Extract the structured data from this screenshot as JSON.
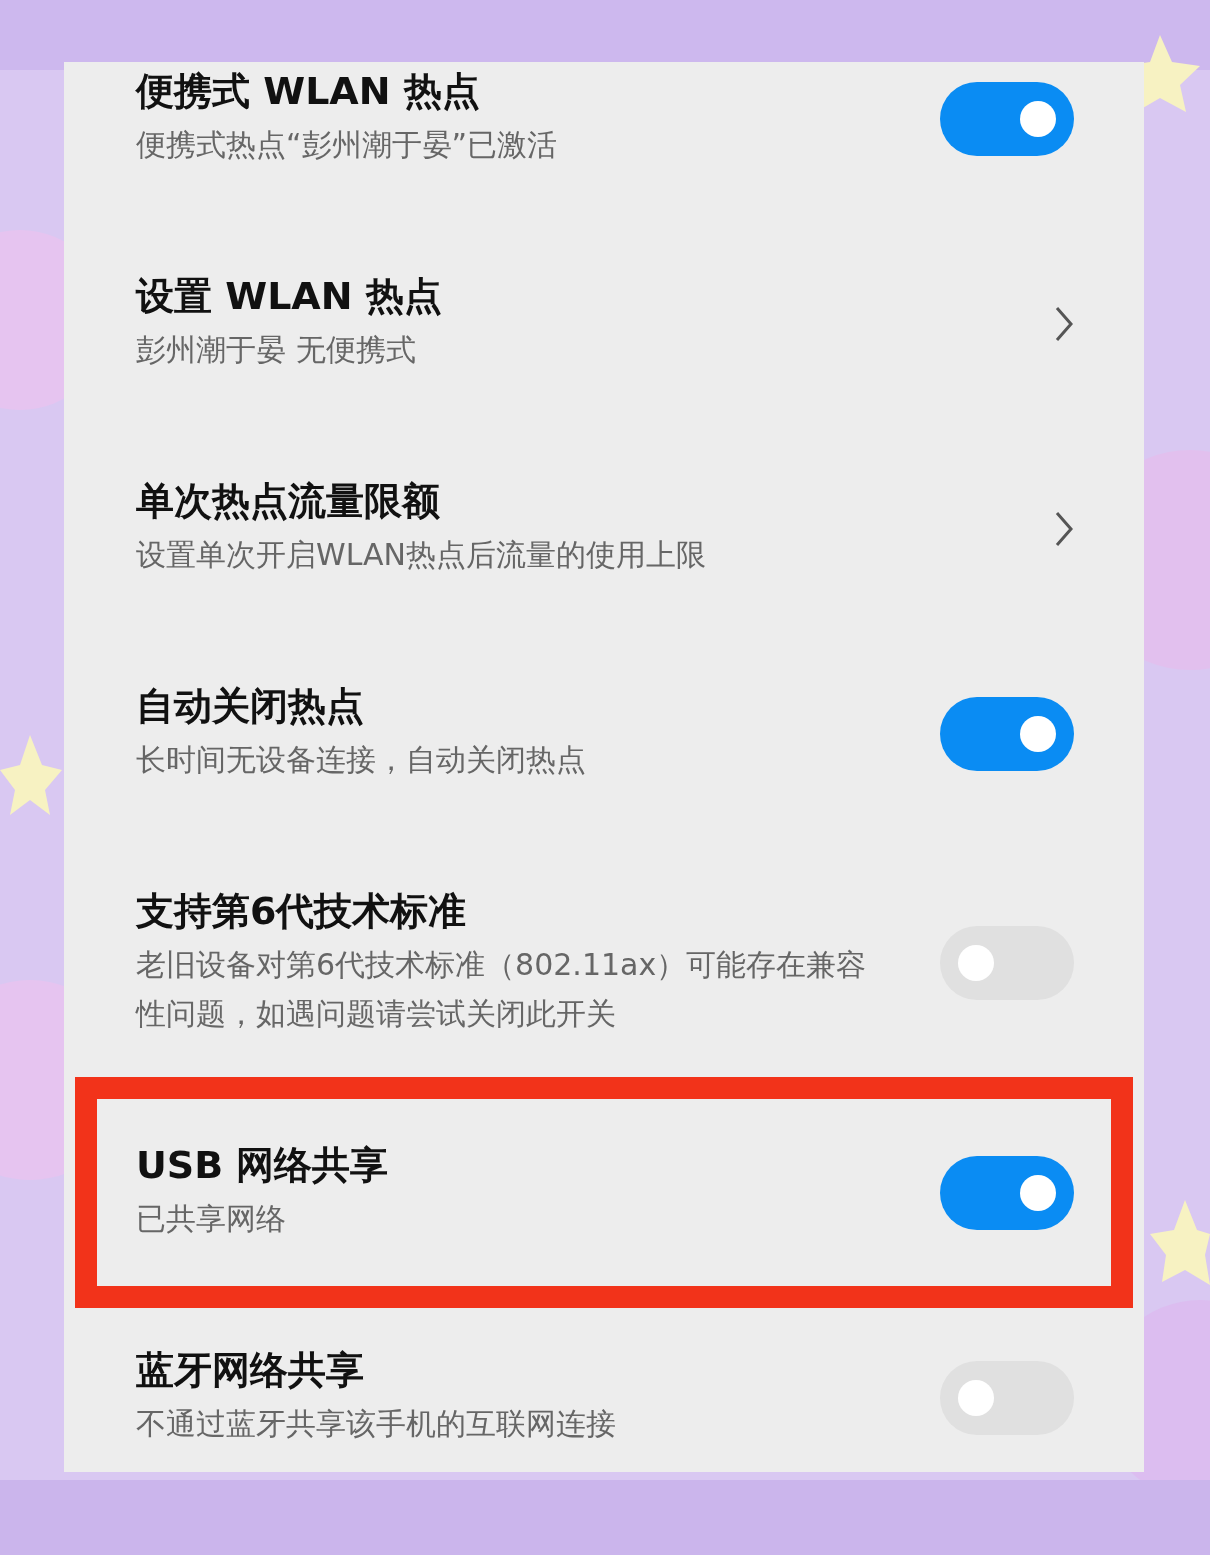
{
  "settings": [
    {
      "kind": "toggle",
      "title": "便携式 WLAN 热点",
      "subtitle": "便携式热点“彭州潮于晏”已激活",
      "on": true,
      "highlighted": false
    },
    {
      "kind": "link",
      "title": "设置 WLAN 热点",
      "subtitle": "彭州潮于晏 无便携式",
      "highlighted": false
    },
    {
      "kind": "link",
      "title": "单次热点流量限额",
      "subtitle": "设置单次开启WLAN热点后流量的使用上限",
      "highlighted": false
    },
    {
      "kind": "toggle",
      "title": "自动关闭热点",
      "subtitle": "长时间无设备连接，自动关闭热点",
      "on": true,
      "highlighted": false
    },
    {
      "kind": "toggle",
      "title": "支持第6代技术标准",
      "subtitle": "老旧设备对第6代技术标准（802.11ax）可能存在兼容性问题，如遇问题请尝试关闭此开关",
      "on": false,
      "highlighted": false
    },
    {
      "kind": "toggle",
      "title": "USB 网络共享",
      "subtitle": "已共享网络",
      "on": true,
      "highlighted": true
    },
    {
      "kind": "toggle",
      "title": "蓝牙网络共享",
      "subtitle": "不通过蓝牙共享该手机的互联网连接",
      "on": false,
      "highlighted": false
    }
  ]
}
